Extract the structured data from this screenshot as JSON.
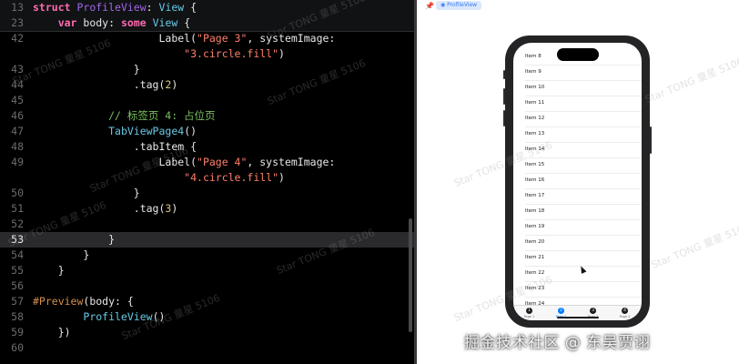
{
  "editor": {
    "lines": [
      {
        "n": "13",
        "tokens": [
          {
            "t": "struct",
            "c": "kw"
          },
          {
            "t": " ",
            "c": ""
          },
          {
            "t": "ProfileView",
            "c": "ty"
          },
          {
            "t": ": ",
            "c": ""
          },
          {
            "t": "View",
            "c": "tyb"
          },
          {
            "t": " {",
            "c": ""
          }
        ],
        "state": "sticky"
      },
      {
        "n": "23",
        "tokens": [
          {
            "t": "    ",
            "c": ""
          },
          {
            "t": "var",
            "c": "kw"
          },
          {
            "t": " body: ",
            "c": ""
          },
          {
            "t": "some",
            "c": "kw"
          },
          {
            "t": " ",
            "c": ""
          },
          {
            "t": "View",
            "c": "tyb"
          },
          {
            "t": " {",
            "c": ""
          }
        ],
        "state": "sticky"
      },
      {
        "n": "42",
        "tokens": [
          {
            "t": "                    Label(",
            "c": ""
          },
          {
            "t": "\"Page 3\"",
            "c": "str"
          },
          {
            "t": ", systemImage:",
            "c": ""
          }
        ],
        "state": ""
      },
      {
        "n": "",
        "tokens": [
          {
            "t": "                        ",
            "c": ""
          },
          {
            "t": "\"3.circle.fill\"",
            "c": "str"
          },
          {
            "t": ")",
            "c": ""
          }
        ],
        "state": ""
      },
      {
        "n": "43",
        "tokens": [
          {
            "t": "                }",
            "c": ""
          }
        ],
        "state": ""
      },
      {
        "n": "44",
        "tokens": [
          {
            "t": "                .tag(",
            "c": ""
          },
          {
            "t": "2",
            "c": "num"
          },
          {
            "t": ")",
            "c": ""
          }
        ],
        "state": ""
      },
      {
        "n": "45",
        "tokens": [],
        "state": ""
      },
      {
        "n": "46",
        "tokens": [
          {
            "t": "            ",
            "c": ""
          },
          {
            "t": "// 标签页 4: 占位页",
            "c": "cm"
          }
        ],
        "state": ""
      },
      {
        "n": "47",
        "tokens": [
          {
            "t": "            ",
            "c": ""
          },
          {
            "t": "TabViewPage4",
            "c": "tyb"
          },
          {
            "t": "()",
            "c": ""
          }
        ],
        "state": ""
      },
      {
        "n": "48",
        "tokens": [
          {
            "t": "                .tabItem {",
            "c": ""
          }
        ],
        "state": ""
      },
      {
        "n": "49",
        "tokens": [
          {
            "t": "                    Label(",
            "c": ""
          },
          {
            "t": "\"Page 4\"",
            "c": "str"
          },
          {
            "t": ", systemImage:",
            "c": ""
          }
        ],
        "state": ""
      },
      {
        "n": "",
        "tokens": [
          {
            "t": "                        ",
            "c": ""
          },
          {
            "t": "\"4.circle.fill\"",
            "c": "str"
          },
          {
            "t": ")",
            "c": ""
          }
        ],
        "state": ""
      },
      {
        "n": "50",
        "tokens": [
          {
            "t": "                }",
            "c": ""
          }
        ],
        "state": ""
      },
      {
        "n": "51",
        "tokens": [
          {
            "t": "                .tag(",
            "c": ""
          },
          {
            "t": "3",
            "c": "num"
          },
          {
            "t": ")",
            "c": ""
          }
        ],
        "state": ""
      },
      {
        "n": "52",
        "tokens": [],
        "state": ""
      },
      {
        "n": "53",
        "tokens": [
          {
            "t": "            }",
            "c": ""
          }
        ],
        "state": "current"
      },
      {
        "n": "54",
        "tokens": [
          {
            "t": "        }",
            "c": ""
          }
        ],
        "state": ""
      },
      {
        "n": "55",
        "tokens": [
          {
            "t": "    }",
            "c": ""
          }
        ],
        "state": ""
      },
      {
        "n": "56",
        "tokens": [],
        "state": ""
      },
      {
        "n": "57",
        "tokens": [
          {
            "t": "#Preview",
            "c": "attr"
          },
          {
            "t": "(body: {",
            "c": ""
          }
        ],
        "state": ""
      },
      {
        "n": "58",
        "tokens": [
          {
            "t": "        ",
            "c": ""
          },
          {
            "t": "ProfileView",
            "c": "tyb"
          },
          {
            "t": "()",
            "c": ""
          }
        ],
        "state": ""
      },
      {
        "n": "59",
        "tokens": [
          {
            "t": "    })",
            "c": ""
          }
        ],
        "state": ""
      },
      {
        "n": "60",
        "tokens": [],
        "state": ""
      }
    ]
  },
  "preview": {
    "badge_label": "ProfileView",
    "list_items": [
      "Item 8",
      "Item 9",
      "Item 10",
      "Item 11",
      "Item 12",
      "Item 13",
      "Item 14",
      "Item 15",
      "Item 16",
      "Item 17",
      "Item 18",
      "Item 19",
      "Item 20",
      "Item 21",
      "Item 22",
      "Item 23",
      "Item 24"
    ],
    "tabs": [
      {
        "glyph": "1",
        "label": "Page 1",
        "active": false
      },
      {
        "glyph": "2",
        "label": "Page 2",
        "active": true
      },
      {
        "glyph": "3",
        "label": "Page 3",
        "active": false
      },
      {
        "glyph": "4",
        "label": "Page 4",
        "active": false
      }
    ]
  },
  "watermark_text": "Star TONG 童星 5106",
  "credit_text": "掘金技术社区 @ 东吴贾诩",
  "colors": {
    "accent": "#007aff",
    "keyword": "#ff6ab0",
    "string": "#ff7f6b",
    "comment": "#7abf5f",
    "type": "#67c9e6"
  }
}
